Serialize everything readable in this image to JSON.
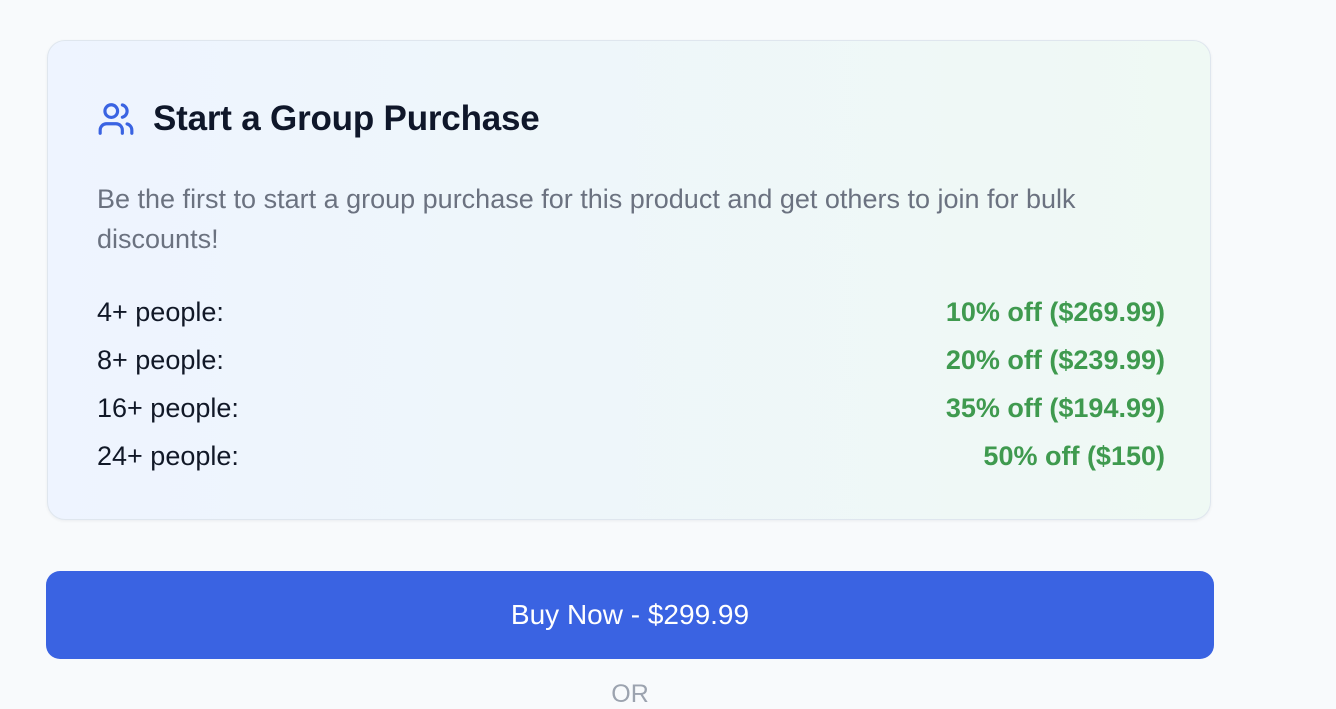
{
  "group_purchase": {
    "icon": "users-icon",
    "title": "Start a Group Purchase",
    "description": "Be the first to start a group purchase for this product and get others to join for bulk discounts!",
    "tiers": [
      {
        "label": "4+ people:",
        "value": "10% off ($269.99)"
      },
      {
        "label": "8+ people:",
        "value": "20% off ($239.99)"
      },
      {
        "label": "16+ people:",
        "value": "35% off ($194.99)"
      },
      {
        "label": "24+ people:",
        "value": "50% off ($150)"
      }
    ]
  },
  "buy_button": {
    "label": "Buy Now - $299.99"
  },
  "divider": {
    "label": "OR"
  },
  "colors": {
    "background": "#f8fafc",
    "primary": "#3a63e2",
    "discount_green": "#3f9a4f",
    "icon_blue": "#3a63e2"
  }
}
